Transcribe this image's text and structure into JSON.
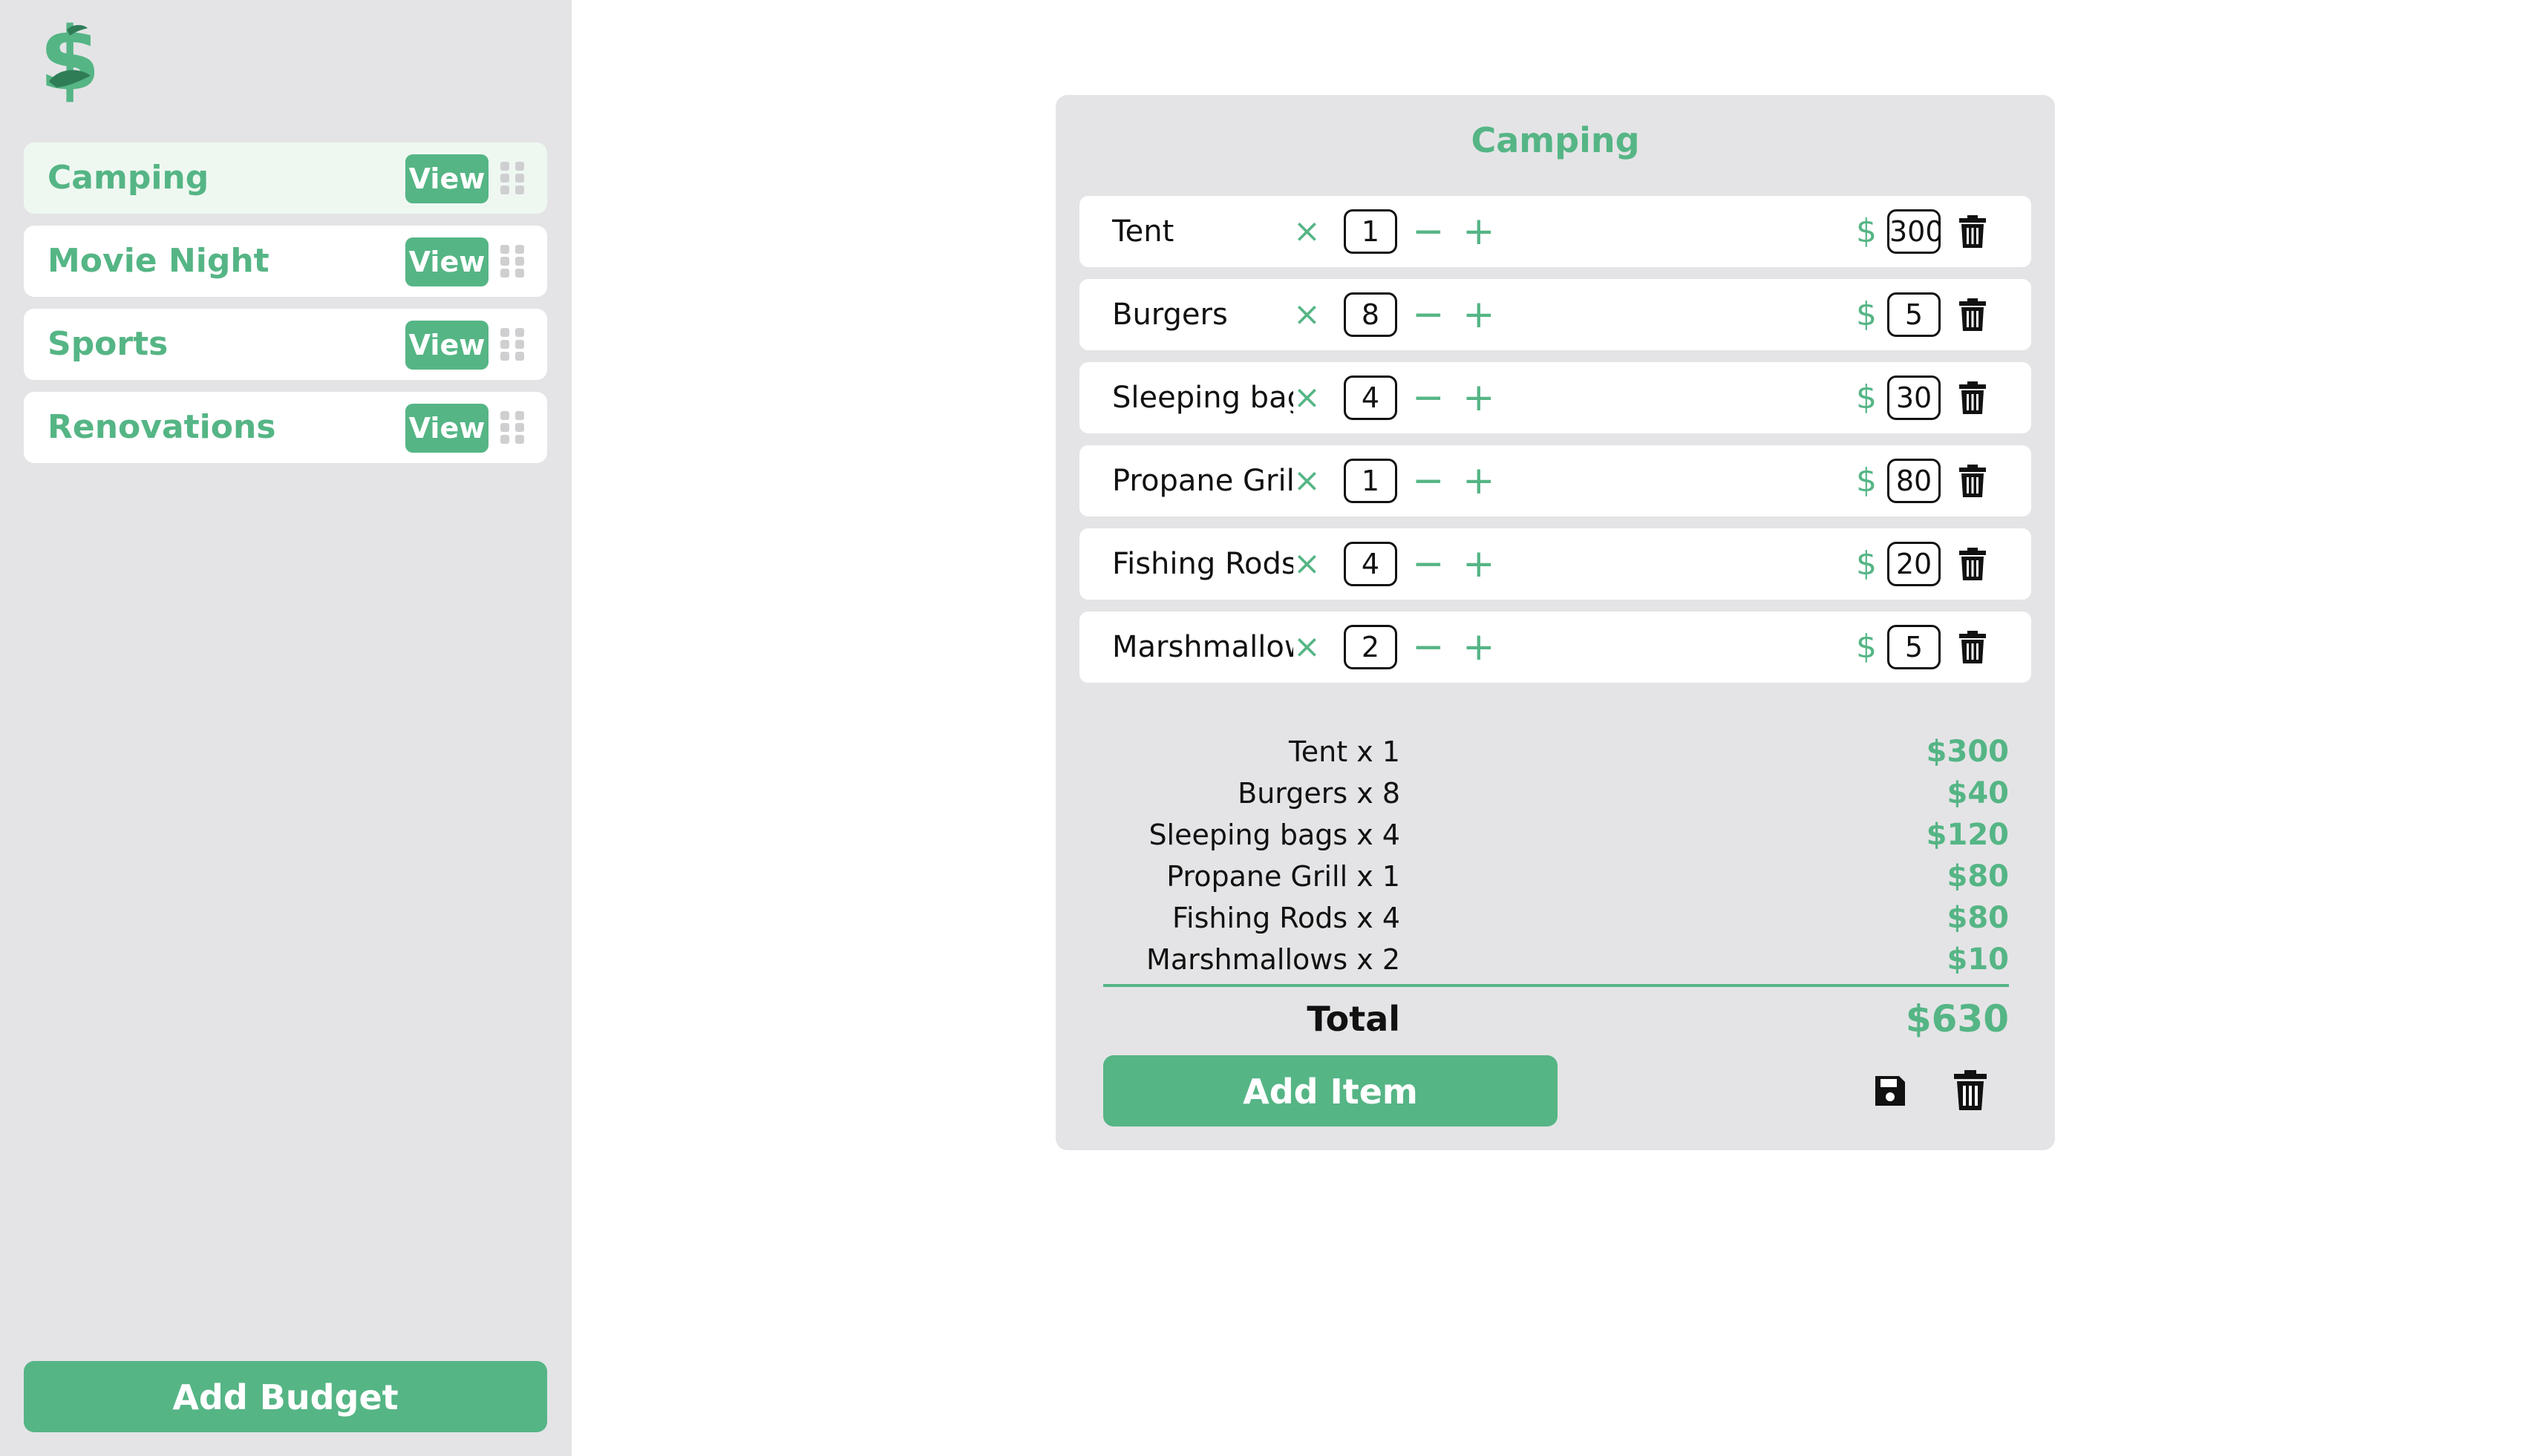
{
  "colors": {
    "accent": "#55b585",
    "sidebar_bg": "#e4e4e6",
    "active_item_bg": "#eef8f1"
  },
  "sidebar": {
    "logo_icon": "dollar-sign-logo",
    "budgets": [
      {
        "name": "Camping",
        "view_label": "View",
        "active": true
      },
      {
        "name": "Movie Night",
        "view_label": "View",
        "active": false
      },
      {
        "name": "Sports",
        "view_label": "View",
        "active": false
      },
      {
        "name": "Renovations",
        "view_label": "View",
        "active": false
      }
    ],
    "add_budget_label": "Add Budget"
  },
  "panel": {
    "title": "Camping",
    "times_symbol": "×",
    "minus_symbol": "−",
    "plus_symbol": "+",
    "currency_symbol": "$",
    "items": [
      {
        "name": "Tent",
        "qty": "1",
        "price": "300"
      },
      {
        "name": "Burgers",
        "qty": "8",
        "price": "5"
      },
      {
        "name": "Sleeping bags",
        "qty": "4",
        "price": "30"
      },
      {
        "name": "Propane Grill",
        "qty": "1",
        "price": "80"
      },
      {
        "name": "Fishing Rods",
        "qty": "4",
        "price": "20"
      },
      {
        "name": "Marshmallows",
        "qty": "2",
        "price": "5"
      }
    ],
    "summary": [
      {
        "label": "Tent x 1",
        "value": "$300"
      },
      {
        "label": "Burgers x 8",
        "value": "$40"
      },
      {
        "label": "Sleeping bags x 4",
        "value": "$120"
      },
      {
        "label": "Propane Grill x 1",
        "value": "$80"
      },
      {
        "label": "Fishing Rods x 4",
        "value": "$80"
      },
      {
        "label": "Marshmallows x 2",
        "value": "$10"
      }
    ],
    "total_label": "Total",
    "total_value": "$630",
    "add_item_label": "Add Item"
  }
}
